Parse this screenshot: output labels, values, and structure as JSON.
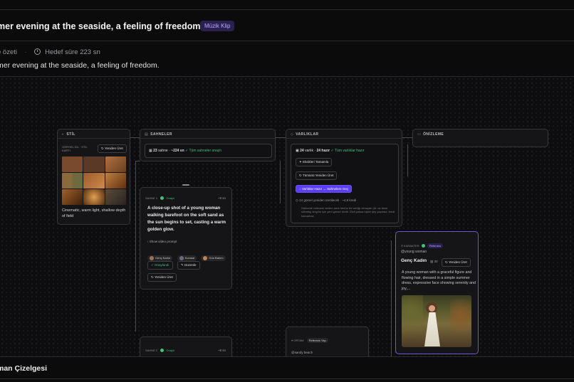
{
  "header": {
    "title": "mer evening at the seaside, a feeling of freedom.",
    "badge": "Müzik Klip"
  },
  "meta": {
    "summary_label": "e özeti",
    "separator": "·",
    "target_duration": "Hedef süre 223 sn"
  },
  "prompt_line": "mer evening at the seaside, a feeling of freedom.",
  "nodes": {
    "style": {
      "header": "STİL",
      "card_label": "GÖRSEL DİL · STİL KARTI",
      "regenerate": "Yeniden Üret",
      "caption": "Cinematic, warm light, shallow depth of field"
    },
    "scenes": {
      "header": "SAHNELER",
      "count": "23",
      "count_label": "sahne ·",
      "duration": "~224 sn",
      "status": "Tüm sahneler onaylı",
      "scene1": {
        "label": "SAHNE 1",
        "status": "Onaylı",
        "duration": "~8 sn",
        "text": "A close-up shot of a young woman walking barefoot on the soft sand as the sun begins to set, casting a warm golden glow.",
        "show_prompt": "Show video prompt",
        "chips": [
          "Genç Kadın",
          "Kumsal",
          "Gün Batımı"
        ],
        "approved_btn": "Onaylandı",
        "edit_btn": "Düzenle",
        "regen_btn": "Yeniden Üret"
      },
      "scene2": {
        "label": "SAHNE 2",
        "status": "Onaylı",
        "duration": "~8 sn"
      }
    },
    "assets": {
      "header": "VARLIKLAR",
      "count": "24",
      "count_label": "varlık ·",
      "ready": "24 hazır",
      "status": "Tüm varlıklar hazır",
      "complete_missing": "Eksikleri Tamamla",
      "regen_all": "Tümünü Yeniden Üret",
      "go_scenes": "Varlıklar Hazır → Sahnelere Geç",
      "credit_note": "24 görsel yeniden üretilecek · ~4,8 kredi",
      "hint": "Sahnede referans verilen ama henüz bir varlığı olmayan (ör. az önce silinmiş) slug'lar için yeni görsel üretir. Gizli yoksa hiçbir şey yapmaz, kredi harcamaz."
    },
    "preview": {
      "header": "ÖNİZLEME"
    },
    "character": {
      "label": "KARAKTER",
      "tag": "Referans",
      "slug": "@young woman",
      "name": "Genç Kadın",
      "count": "30",
      "regen": "Yeniden Üret",
      "description": "A young woman with a graceful figure and flowing hair, dressed in a simple summer dress, expressive face showing serenity and joy,..."
    },
    "location": {
      "label": "ORTAM",
      "tag": "Referans Yap",
      "slug": "@sandy beach"
    }
  },
  "timeline": {
    "label": "man Çizelgesi"
  },
  "colors": {
    "accent": "#5b3df5",
    "success": "#3fc27a",
    "badge_bg": "#2b2150",
    "badge_fg": "#b9a6ff"
  }
}
